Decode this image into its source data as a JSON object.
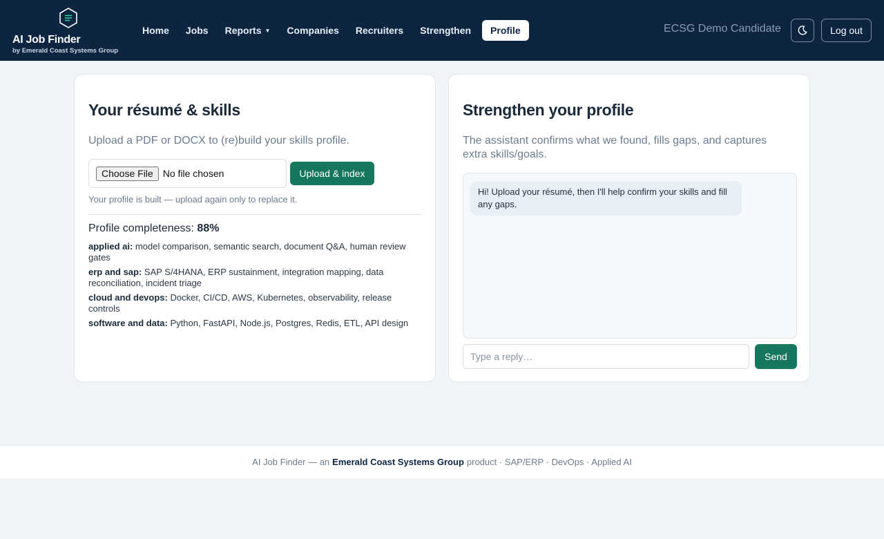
{
  "header": {
    "brand_title": "AI Job Finder",
    "brand_subtitle": "by Emerald Coast Systems Group",
    "nav": [
      {
        "label": "Home"
      },
      {
        "label": "Jobs"
      },
      {
        "label": "Reports"
      },
      {
        "label": "Companies"
      },
      {
        "label": "Recruiters"
      },
      {
        "label": "Strengthen"
      },
      {
        "label": "Profile"
      }
    ],
    "active_nav": "Profile",
    "user_name": "ECSG Demo Candidate",
    "logout_label": "Log out",
    "theme_icon": "moon-icon"
  },
  "resume": {
    "title": "Your résumé & skills",
    "lead": "Upload a PDF or DOCX to (re)build your skills profile.",
    "choose_file_label": "Choose File",
    "no_file_text": "No file chosen",
    "upload_label": "Upload & index",
    "built_note": "Your profile is built — upload again only to replace it.",
    "completeness_label": "Profile completeness:",
    "completeness_value": "88%",
    "skills": [
      {
        "category": "applied ai:",
        "items": "model comparison, semantic search, document Q&A, human review gates"
      },
      {
        "category": "erp and sap:",
        "items": "SAP S/4HANA, ERP sustainment, integration mapping, data reconciliation, incident triage"
      },
      {
        "category": "cloud and devops:",
        "items": "Docker, CI/CD, AWS, Kubernetes, observability, release controls"
      },
      {
        "category": "software and data:",
        "items": "Python, FastAPI, Node.js, Postgres, Redis, ETL, API design"
      }
    ]
  },
  "strengthen": {
    "title": "Strengthen your profile",
    "lead": "The assistant confirms what we found, fills gaps, and captures extra skills/goals.",
    "assistant_message": "Hi! Upload your résumé, then I'll help confirm your skills and fill any gaps.",
    "reply_placeholder": "Type a reply…",
    "send_label": "Send"
  },
  "footer": {
    "prefix": "AI Job Finder — an",
    "company": "Emerald Coast Systems Group",
    "suffix": "product · SAP/ERP · DevOps · Applied AI"
  },
  "colors": {
    "navbar": "#0d2540",
    "accent": "#16775e",
    "page_bg": "#f1f4f7"
  }
}
